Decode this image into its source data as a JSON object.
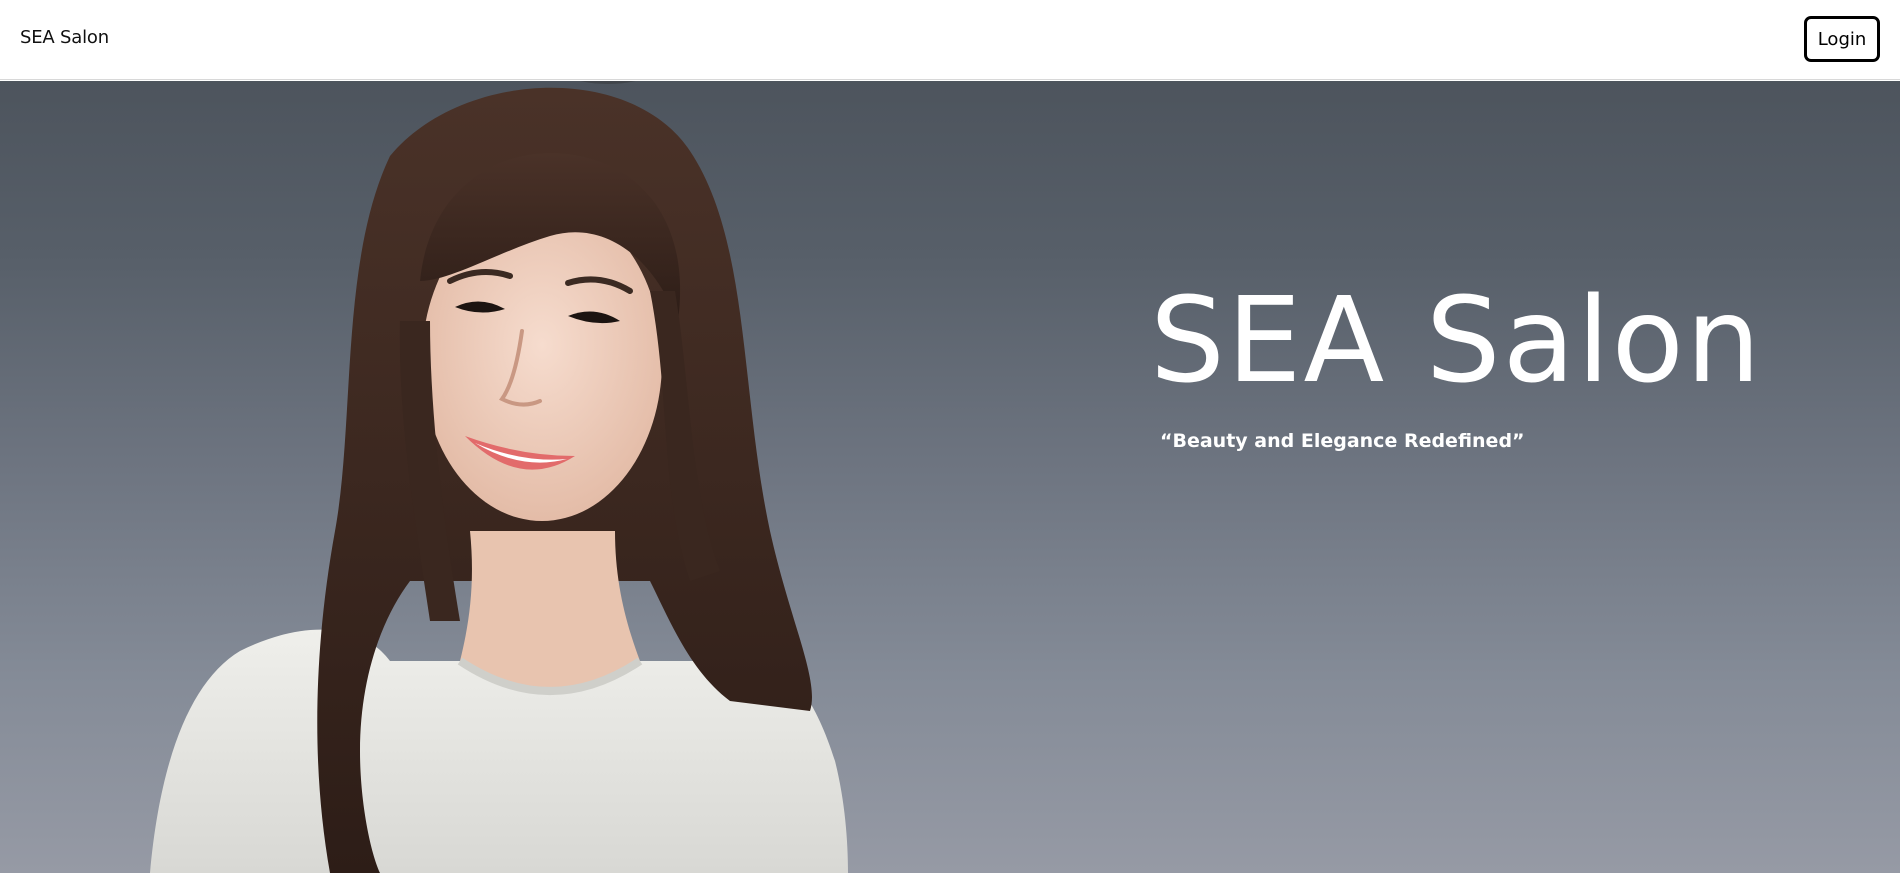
{
  "navbar": {
    "brand": "SEA Salon",
    "login_label": "Login"
  },
  "hero": {
    "title": "SEA Salon",
    "tagline": "“Beauty and Elegance Redefined”"
  },
  "colors": {
    "navbar_bg": "#ffffff",
    "hero_gradient_top": "#4d545d",
    "hero_gradient_bottom": "#969aa5",
    "hero_text": "#ffffff"
  }
}
